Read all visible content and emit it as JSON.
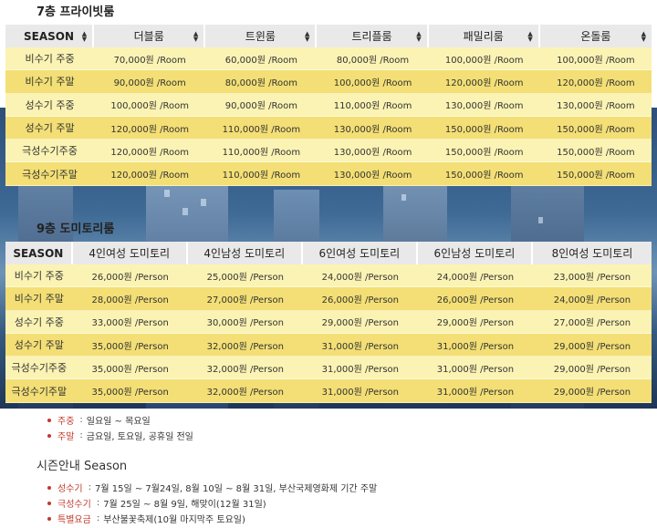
{
  "section1": {
    "title": "7층 프라이빗룸",
    "headers": [
      "SEASON",
      "더블룸",
      "트윈룸",
      "트리플룸",
      "패밀리룸",
      "온돌룸"
    ],
    "rows": [
      [
        "비수기 주중",
        "70,000원 /Room",
        "60,000원 /Room",
        "80,000원 /Room",
        "100,000원 /Room",
        "100,000원 /Room"
      ],
      [
        "비수기 주말",
        "90,000원 /Room",
        "80,000원 /Room",
        "100,000원 /Room",
        "120,000원 /Room",
        "120,000원 /Room"
      ],
      [
        "성수기 주중",
        "100,000원 /Room",
        "90,000원 /Room",
        "110,000원 /Room",
        "130,000원 /Room",
        "130,000원 /Room"
      ],
      [
        "성수기 주말",
        "120,000원 /Room",
        "110,000원 /Room",
        "130,000원 /Room",
        "150,000원 /Room",
        "150,000원 /Room"
      ],
      [
        "극성수기주중",
        "120,000원 /Room",
        "110,000원 /Room",
        "130,000원 /Room",
        "150,000원 /Room",
        "150,000원 /Room"
      ],
      [
        "극성수기주말",
        "120,000원 /Room",
        "110,000원 /Room",
        "130,000원 /Room",
        "150,000원 /Room",
        "150,000원 /Room"
      ]
    ]
  },
  "section2": {
    "title": "9층 도미토리룸",
    "headers": [
      "SEASON",
      "4인여성 도미토리",
      "4인남성 도미토리",
      "6인여성 도미토리",
      "6인남성 도미토리",
      "8인여성 도미토리"
    ],
    "rows": [
      [
        "비수기 주중",
        "26,000원 /Person",
        "25,000원 /Person",
        "24,000원 /Person",
        "24,000원 /Person",
        "23,000원 /Person"
      ],
      [
        "비수기 주말",
        "28,000원 /Person",
        "27,000원 /Person",
        "26,000원 /Person",
        "26,000원 /Person",
        "24,000원 /Person"
      ],
      [
        "성수기 주중",
        "33,000원 /Person",
        "30,000원 /Person",
        "29,000원 /Person",
        "29,000원 /Person",
        "27,000원 /Person"
      ],
      [
        "성수기 주말",
        "35,000원 /Person",
        "32,000원 /Person",
        "31,000원 /Person",
        "31,000원 /Person",
        "29,000원 /Person"
      ],
      [
        "극성수기주중",
        "35,000원 /Person",
        "32,000원 /Person",
        "31,000원 /Person",
        "31,000원 /Person",
        "29,000원 /Person"
      ],
      [
        "극성수기주말",
        "35,000원 /Person",
        "32,000원 /Person",
        "31,000원 /Person",
        "31,000원 /Person",
        "29,000원 /Person"
      ]
    ]
  },
  "week_notes": [
    {
      "label": "주중",
      "text": "일요일 ~ 목요일"
    },
    {
      "label": "주말",
      "text": "금요일, 토요일, 공휴일 전일"
    }
  ],
  "season_info": {
    "title": "시즌안내 Season",
    "items": [
      {
        "label": "성수기",
        "text": "7월 15일 ~ 7월24일, 8월 10일 ~ 8월 31일, 부산국제영화제 기간 주말"
      },
      {
        "label": "극성수기",
        "text": "7월 25일 ~ 8월 9일, 해맞이(12월 31일)"
      },
      {
        "label": "특별요금",
        "text": "부산불꽃축제(10월 마지막주 토요일)"
      }
    ]
  },
  "icons": {
    "sort": "sort-updown-icon",
    "bullet": "bullet-dot-icon"
  },
  "colors": {
    "row_light": "#fbf3b3",
    "row_dark": "#f3df75",
    "header_bg": "#e9e9e9",
    "accent_red": "#c0392b"
  }
}
